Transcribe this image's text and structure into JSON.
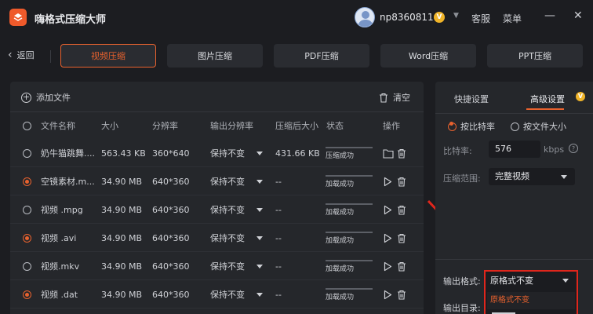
{
  "app": {
    "title": "嗨格式压缩大师"
  },
  "user": {
    "name": "np8360811",
    "vip_badge": "V"
  },
  "header": {
    "service": "客服",
    "menu": "菜单",
    "minimize": "—",
    "close": "✕"
  },
  "nav": {
    "back": "返回",
    "tabs": [
      {
        "label": "视频压缩",
        "active": true
      },
      {
        "label": "图片压缩",
        "active": false
      },
      {
        "label": "PDF压缩",
        "active": false
      },
      {
        "label": "Word压缩",
        "active": false
      },
      {
        "label": "PPT压缩",
        "active": false
      }
    ]
  },
  "toolbar": {
    "add_file": "添加文件",
    "clear": "清空"
  },
  "table": {
    "headers": [
      "文件名称",
      "大小",
      "分辨率",
      "输出分辨率",
      "压缩后大小",
      "状态",
      "操作"
    ],
    "rows": [
      {
        "checked": false,
        "name": "奶牛猫跳舞....",
        "size": "563.43 KB",
        "res": "360*640",
        "out_res": "保持不变",
        "after": "431.66 KB",
        "status": "压缩成功",
        "op": "folder"
      },
      {
        "checked": true,
        "name": "空镜素材.m...",
        "size": "34.90 MB",
        "res": "640*360",
        "out_res": "保持不变",
        "after": "--",
        "status": "加载成功",
        "op": "play"
      },
      {
        "checked": false,
        "name": "视频 .mpg",
        "size": "34.90 MB",
        "res": "640*360",
        "out_res": "保持不变",
        "after": "--",
        "status": "加载成功",
        "op": "play"
      },
      {
        "checked": true,
        "name": "视频 .avi",
        "size": "34.90 MB",
        "res": "640*360",
        "out_res": "保持不变",
        "after": "--",
        "status": "加载成功",
        "op": "play"
      },
      {
        "checked": false,
        "name": "视频.mkv",
        "size": "34.90 MB",
        "res": "640*360",
        "out_res": "保持不变",
        "after": "--",
        "status": "加载成功",
        "op": "play"
      },
      {
        "checked": true,
        "name": "视频 .dat",
        "size": "34.90 MB",
        "res": "640*360",
        "out_res": "保持不变",
        "after": "--",
        "status": "加载成功",
        "op": "play"
      }
    ]
  },
  "settings": {
    "tab_quick": "快捷设置",
    "tab_advanced": "高级设置",
    "vip": "V",
    "mode_bitrate": "按比特率",
    "mode_filesize": "按文件大小",
    "bitrate_label": "比特率:",
    "bitrate_value": "576",
    "bitrate_unit": "kbps",
    "help": "?",
    "range_label": "压缩范围:",
    "range_value": "完整视频",
    "output_format_label": "输出格式:",
    "output_format_value": "原格式不变",
    "output_format_option": "原格式不变",
    "output_dir_label": "输出目录:"
  },
  "colors": {
    "accent": "#e8622e",
    "highlight_box": "#e0261c",
    "vip": "#f0b429"
  }
}
